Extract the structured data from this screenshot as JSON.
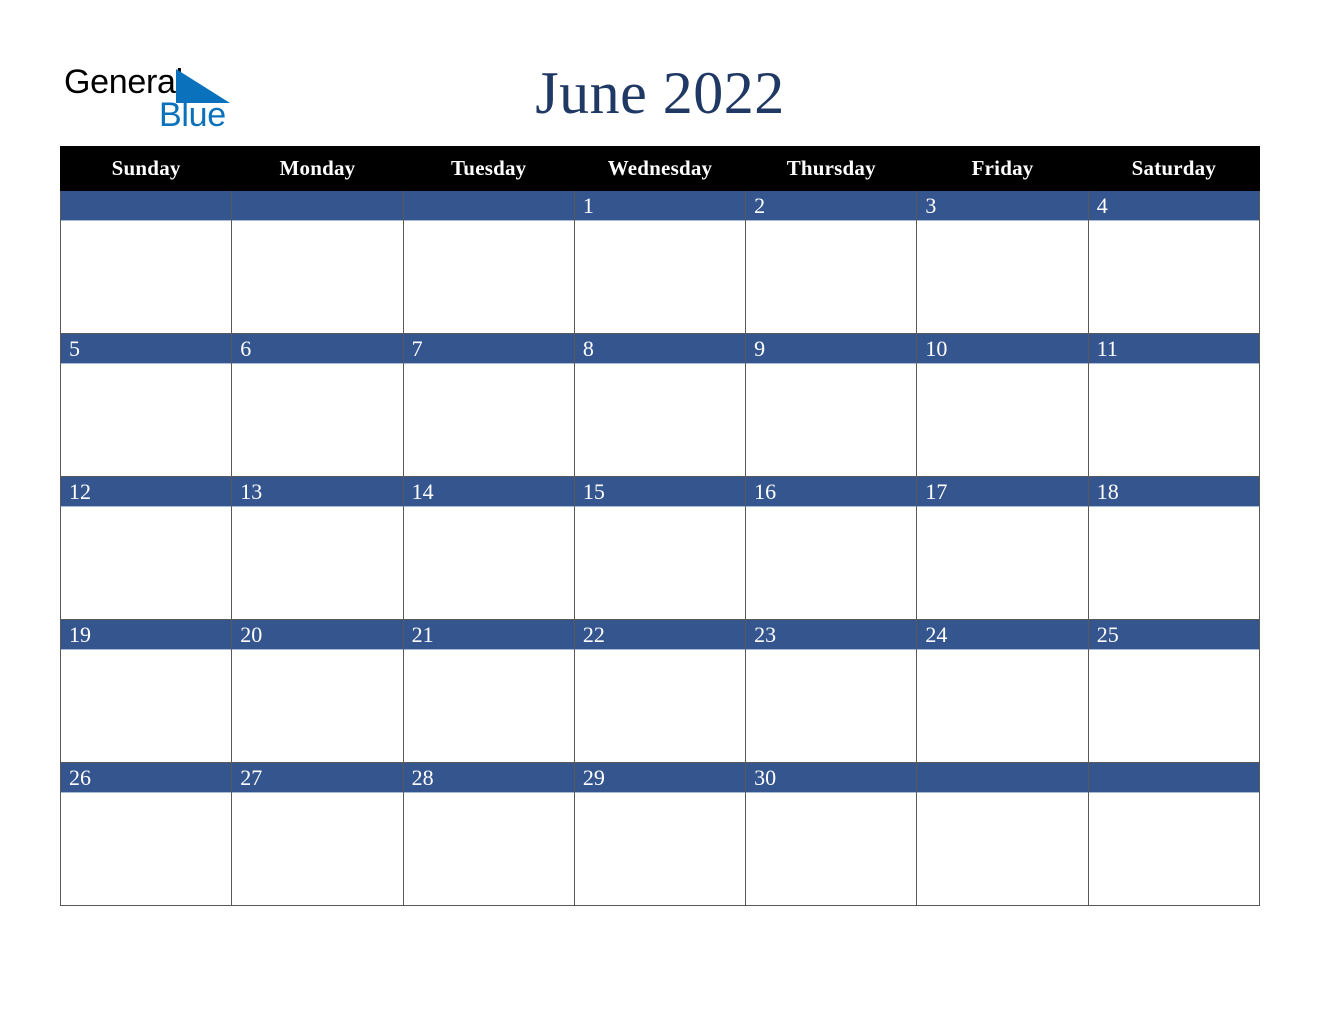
{
  "brand": {
    "name_part1": "General",
    "name_part2": "Blue",
    "triangle_icon": "triangle-icon",
    "logo_blue": "#0a72bc"
  },
  "header": {
    "title": "June 2022",
    "title_color": "#1f3864"
  },
  "calendar": {
    "month": "June",
    "year": "2022",
    "header_bg": "#000000",
    "band_color": "#35558f",
    "border_color": "#595959",
    "weekday_headers": [
      "Sunday",
      "Monday",
      "Tuesday",
      "Wednesday",
      "Thursday",
      "Friday",
      "Saturday"
    ],
    "weeks": [
      [
        "",
        "",
        "",
        "1",
        "2",
        "3",
        "4"
      ],
      [
        "5",
        "6",
        "7",
        "8",
        "9",
        "10",
        "11"
      ],
      [
        "12",
        "13",
        "14",
        "15",
        "16",
        "17",
        "18"
      ],
      [
        "19",
        "20",
        "21",
        "22",
        "23",
        "24",
        "25"
      ],
      [
        "26",
        "27",
        "28",
        "29",
        "30",
        "",
        ""
      ]
    ]
  }
}
